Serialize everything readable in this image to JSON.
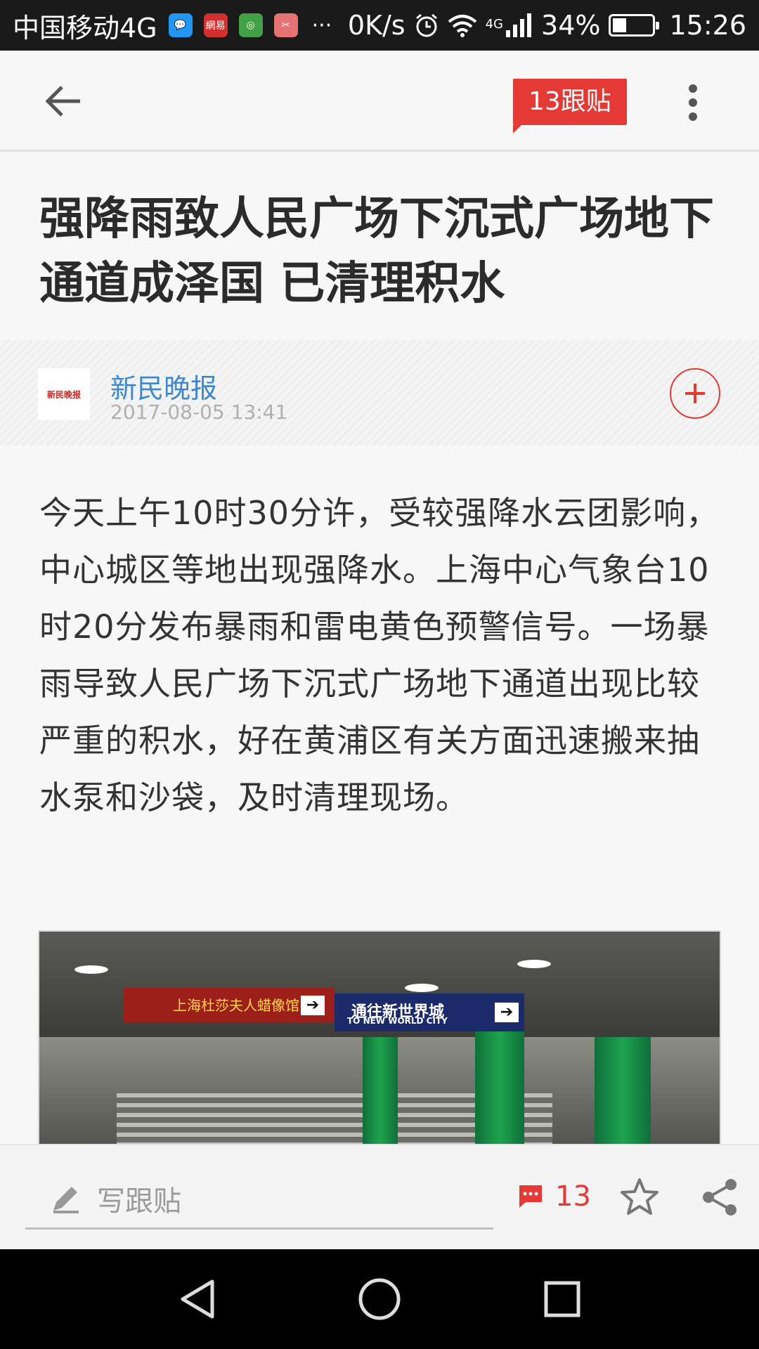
{
  "status_bar": {
    "carrier": "中国移动4G",
    "app_icons": [
      {
        "name": "chat-app-icon",
        "color": "#2196f3",
        "glyph": "💬"
      },
      {
        "name": "netease-app-icon",
        "color": "#d32f2f",
        "glyph": "網易"
      },
      {
        "name": "browser-app-icon",
        "color": "#43a047",
        "glyph": "◎"
      },
      {
        "name": "tool-app-icon",
        "color": "#e57373",
        "glyph": "✂"
      }
    ],
    "more": "···",
    "speed": "0K/s",
    "network": "4G",
    "battery": "34%",
    "battery_level": 0.34,
    "time": "15:26"
  },
  "header": {
    "reply_badge": "13跟贴"
  },
  "article": {
    "title": "强降雨致人民广场下沉式广场地下通道成泽国 已清理积水",
    "source": {
      "logo_text": "新民晚报",
      "name": "新民晚报",
      "time": "2017-08-05 13:41"
    },
    "body": "今天上午10时30分许，受较强降水云团影响，中心城区等地出现强降水。上海中心气象台10时20分发布暴雨和雷电黄色预警信号。一场暴雨导致人民广场下沉式广场地下通道出现比较严重的积水，好在黄浦区有关方面迅速搬来抽水泵和沙袋，及时清理现场。",
    "photo": {
      "sign_red": "上海杜莎夫人蜡像馆",
      "sign_blue": "通往新世界城",
      "sign_blue_sub": "TO NEW WORLD CITY",
      "arrow": "➔"
    }
  },
  "bottom_bar": {
    "placeholder": "写跟贴",
    "comment_count": "13"
  },
  "colors": {
    "accent": "#e53935",
    "source_blue": "#3b88d1"
  }
}
